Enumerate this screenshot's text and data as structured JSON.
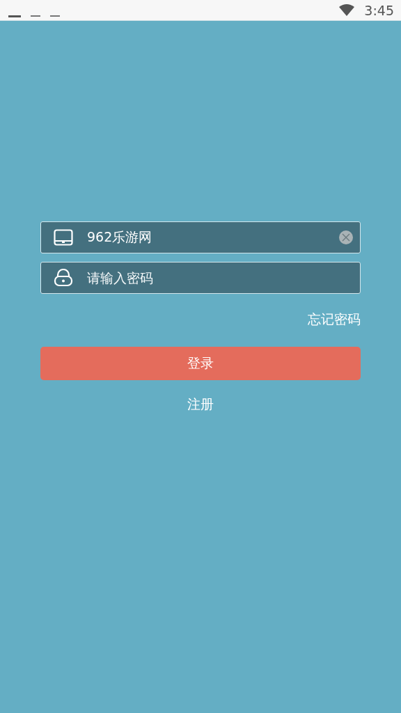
{
  "status_bar": {
    "time": "3:45"
  },
  "username": {
    "value": "962乐游网"
  },
  "password": {
    "placeholder": "请输入密码"
  },
  "forgot_link": "忘记密码",
  "login_button": "登录",
  "register_link": "注册"
}
